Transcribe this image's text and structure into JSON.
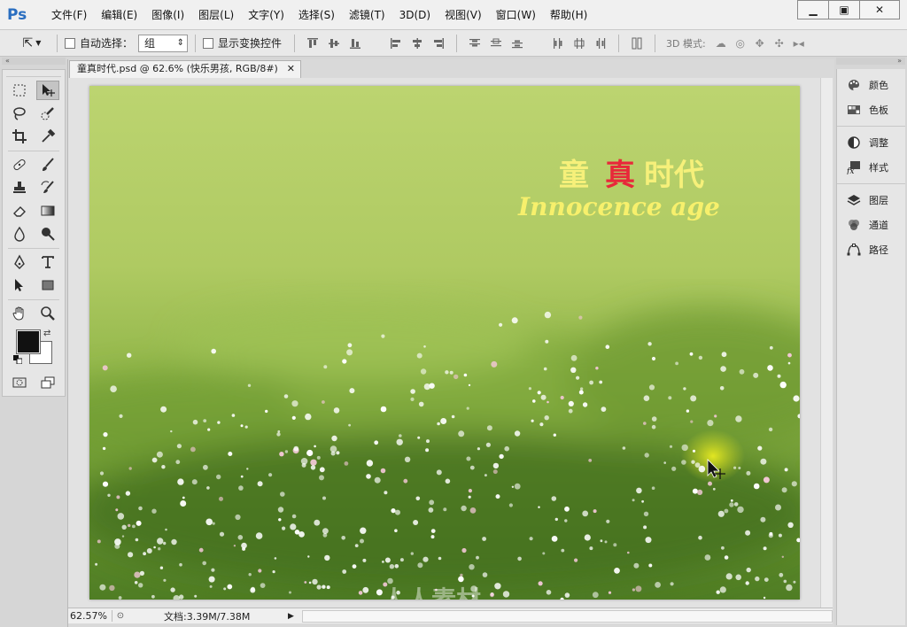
{
  "app": {
    "logo": "Ps"
  },
  "menu": [
    "文件(F)",
    "编辑(E)",
    "图像(I)",
    "图层(L)",
    "文字(Y)",
    "选择(S)",
    "滤镜(T)",
    "3D(D)",
    "视图(V)",
    "窗口(W)",
    "帮助(H)"
  ],
  "options_bar": {
    "auto_select_label": "自动选择：",
    "auto_select_value": "组",
    "show_transform_label": "显示变换控件",
    "mode3d_label": "3D 模式:"
  },
  "document": {
    "tab_title": "童真时代.psd @ 62.6% (快乐男孩, RGB/8#)",
    "title_cn_1": "童",
    "title_cn_2": "真",
    "title_cn_3": "时代",
    "title_en": "Innocence age"
  },
  "status": {
    "zoom": "62.57%",
    "doc_size": "文档:3.39M/7.38M"
  },
  "panels": [
    {
      "label": "颜色",
      "icon": "palette-icon"
    },
    {
      "label": "色板",
      "icon": "swatches-icon"
    },
    {
      "label": "调整",
      "icon": "adjustments-icon"
    },
    {
      "label": "样式",
      "icon": "styles-fx-icon"
    },
    {
      "label": "图层",
      "icon": "layers-icon"
    },
    {
      "label": "通道",
      "icon": "channels-icon"
    },
    {
      "label": "路径",
      "icon": "paths-icon"
    }
  ],
  "colors": {
    "foreground": "#111111",
    "background": "#ffffff",
    "title_yellow": "#f6f07a",
    "title_red": "#e8283a",
    "ps_blue": "#2a6ec0"
  },
  "watermark": "人人素材"
}
